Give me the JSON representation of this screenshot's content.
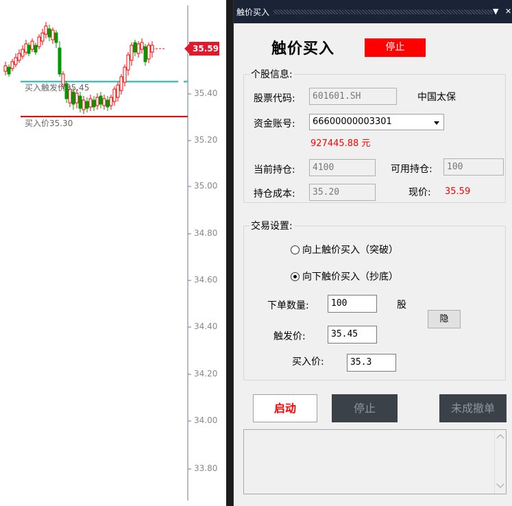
{
  "chart": {
    "current_price": "35.59",
    "y_ticks": [
      "35.40",
      "35.20",
      "35.00",
      "34.80",
      "34.60",
      "34.40",
      "34.20",
      "34.00",
      "33.80"
    ],
    "trigger_line_label": "买入触发价35.45",
    "buy_line_label": "买入价35.30",
    "colors": {
      "up": "#ff0000",
      "down": "#009900",
      "trigger_line": "#3fbfb6",
      "buy_line": "#ff0000",
      "badge": "#e0192c"
    }
  },
  "window": {
    "title": "触价买入",
    "pin_icon": "chevron-down-icon",
    "close_icon": "close-icon"
  },
  "header": {
    "title": "触价买入",
    "status_button": "停止"
  },
  "stock_info": {
    "legend": "个股信息:",
    "code_label": "股票代码:",
    "code_value": "601601.SH",
    "stock_name": "中国太保",
    "account_label": "资金账号:",
    "account_value": "66600000003301",
    "balance": "927445.88 元",
    "position_label": "当前持仓:",
    "position_value": "4100",
    "available_label": "可用持仓:",
    "available_value": "100",
    "cost_label": "持仓成本:",
    "cost_value": "35.20",
    "price_label": "现价:",
    "price_value": "35.59"
  },
  "trade": {
    "legend": "交易设置:",
    "option_up": "向上触价买入（突破）",
    "option_down": "向下触价买入（抄底）",
    "quantity_label": "下单数量:",
    "quantity_value": "100",
    "quantity_unit": "股",
    "hide_button": "隐",
    "trigger_label": "触发价:",
    "trigger_value": "35.45",
    "buy_label": "买入价:",
    "buy_value": "35.3"
  },
  "actions": {
    "start": "启动",
    "stop": "停止",
    "cancel_unfilled": "未成撤单"
  }
}
